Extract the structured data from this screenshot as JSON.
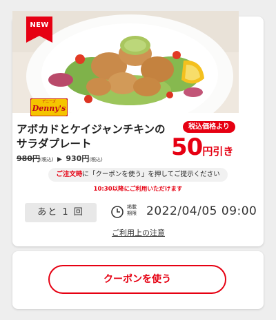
{
  "coupon": {
    "badge": "NEW",
    "brand_logo": "Denny's",
    "brand_logo_kana": "デニーズ",
    "title_line1": "アボカドとケイジャンチキンの",
    "title_line2": "サラダプレート",
    "old_price": "980円",
    "old_price_tax": "(税込)",
    "price_arrow": "▶",
    "new_price": "930円",
    "new_price_tax": "(税込)",
    "tax_label": "税込価格より",
    "discount_value": "50",
    "discount_unit": "円引き",
    "notice_red": "ご注文時",
    "notice_rest": "に「クーポンを使う」を押してご提示ください",
    "time_note": "10:30以降にご利用いただけます",
    "remaining_label": "あと 1 回",
    "period_label_line1": "掲載",
    "period_label_line2": "期限",
    "expiry": "2022/04/05 09:00",
    "terms_link": "ご利用上の注意"
  },
  "actions": {
    "use_coupon": "クーポンを使う"
  },
  "colors": {
    "accent": "#e60012",
    "background": "#eeeeee",
    "card": "#ffffff"
  }
}
